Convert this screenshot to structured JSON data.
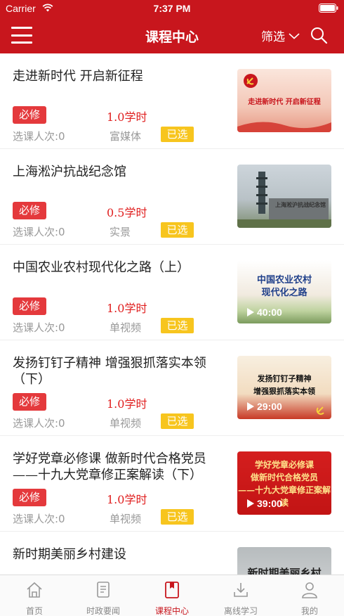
{
  "status_bar": {
    "carrier": "Carrier",
    "time": "7:37 PM"
  },
  "nav": {
    "title": "课程中心",
    "filter_label": "筛选"
  },
  "colors": {
    "brand_red": "#c8161d",
    "required_red": "#e4393c",
    "selected_yellow": "#f7c51e",
    "credit_red": "#e02020"
  },
  "icons": [
    "menu-icon",
    "chevron-down-icon",
    "search-icon",
    "home-icon",
    "news-icon",
    "course-center-icon",
    "download-icon",
    "profile-icon",
    "play-icon"
  ],
  "courses": [
    {
      "title": "走进新时代 开启新征程",
      "badge": "必修",
      "credit": "1.0学时",
      "enroll": "选课人次:0",
      "type": "富媒体",
      "status": "已选",
      "thumb_caption": "走进新时代 开启新征程",
      "duration": ""
    },
    {
      "title": "上海淞沪抗战纪念馆",
      "badge": "必修",
      "credit": "0.5学时",
      "enroll": "选课人次:0",
      "type": "实景",
      "status": "已选",
      "thumb_caption": "上海淞沪抗战纪念馆",
      "duration": ""
    },
    {
      "title": "中国农业农村现代化之路（上）",
      "badge": "必修",
      "credit": "1.0学时",
      "enroll": "选课人次:0",
      "type": "单视频",
      "status": "已选",
      "thumb_caption": "中国农业农村\n现代化之路",
      "duration": "40:00"
    },
    {
      "title": "发扬钉钉子精神 增强狠抓落实本领（下）",
      "badge": "必修",
      "credit": "1.0学时",
      "enroll": "选课人次:0",
      "type": "单视频",
      "status": "已选",
      "thumb_caption": "发扬钉钉子精神\n增强狠抓落实本领",
      "duration": "29:00"
    },
    {
      "title": "学好党章必修课 做新时代合格党员——十九大党章修正案解读（下）",
      "badge": "必修",
      "credit": "1.0学时",
      "enroll": "选课人次:0",
      "type": "单视频",
      "status": "已选",
      "thumb_caption": "学好党章必修课\n做新时代合格党员\n——十九大党章修正案解读",
      "duration": "39:00"
    },
    {
      "title": "新时期美丽乡村建设",
      "badge": "",
      "credit": "",
      "enroll": "",
      "type": "",
      "status": "",
      "thumb_caption": "新时期美丽乡村",
      "duration": ""
    }
  ],
  "tabs": [
    {
      "label": "首页",
      "active": false
    },
    {
      "label": "时政要闻",
      "active": false
    },
    {
      "label": "课程中心",
      "active": true
    },
    {
      "label": "离线学习",
      "active": false
    },
    {
      "label": "我的",
      "active": false
    }
  ]
}
